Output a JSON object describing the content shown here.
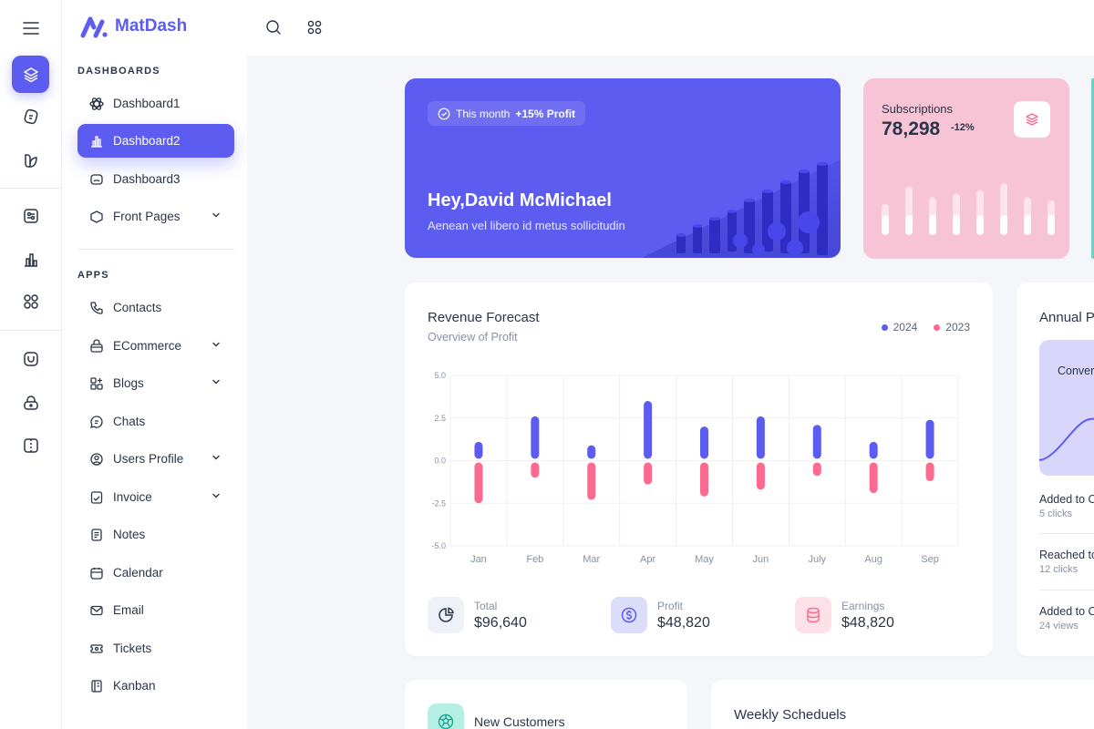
{
  "brand": {
    "name": "MatDash"
  },
  "sidebar": {
    "section_dashboards": "DASHBOARDS",
    "section_apps": "APPS",
    "dashboards": [
      {
        "label": "Dashboard1",
        "icon": "atom-icon"
      },
      {
        "label": "Dashboard2",
        "icon": "bar-chart-icon",
        "active": true
      },
      {
        "label": "Dashboard3",
        "icon": "monitor-icon"
      },
      {
        "label": "Front Pages",
        "icon": "hexagon-icon",
        "has_submenu": true
      }
    ],
    "apps": [
      {
        "label": "Contacts",
        "icon": "phone-icon"
      },
      {
        "label": "ECommerce",
        "icon": "basket-icon",
        "has_submenu": true
      },
      {
        "label": "Blogs",
        "icon": "blocks-icon",
        "has_submenu": true
      },
      {
        "label": "Chats",
        "icon": "chat-icon"
      },
      {
        "label": "Users Profile",
        "icon": "user-circle-icon",
        "has_submenu": true
      },
      {
        "label": "Invoice",
        "icon": "invoice-icon",
        "has_submenu": true
      },
      {
        "label": "Notes",
        "icon": "notes-icon"
      },
      {
        "label": "Calendar",
        "icon": "calendar-icon"
      },
      {
        "label": "Email",
        "icon": "mail-icon"
      },
      {
        "label": "Tickets",
        "icon": "ticket-icon"
      },
      {
        "label": "Kanban",
        "icon": "kanban-icon"
      }
    ]
  },
  "hero": {
    "badge_prefix": "This month",
    "badge_value": "+15% Profit",
    "title": "Hey,David McMichael",
    "subtitle": "Aenean vel libero id metus sollicitudin"
  },
  "subscriptions": {
    "label": "Subscriptions",
    "value": "78,298",
    "change": "-12%",
    "bar_levels": [
      0.45,
      0.7,
      0.55,
      0.6,
      0.65,
      0.75,
      0.55,
      0.5
    ]
  },
  "revenue": {
    "title": "Revenue Forecast",
    "subtitle": "Overview of Profit",
    "stats": [
      {
        "label": "Total",
        "value": "$96,640",
        "icon": "pie-chart-icon"
      },
      {
        "label": "Profit",
        "value": "$48,820",
        "icon": "dollar-icon"
      },
      {
        "label": "Earnings",
        "value": "$48,820",
        "icon": "database-icon"
      }
    ]
  },
  "chart_data": {
    "type": "bar",
    "categories": [
      "Jan",
      "Feb",
      "Mar",
      "Apr",
      "May",
      "Jun",
      "July",
      "Aug",
      "Sep"
    ],
    "series": [
      {
        "name": "2024",
        "color": "#5d5cf0",
        "values": [
          1.1,
          2.6,
          0.9,
          3.5,
          2.0,
          2.6,
          2.1,
          1.1,
          2.4
        ]
      },
      {
        "name": "2023",
        "color": "#fb6a8f",
        "values": [
          -2.5,
          -1.0,
          -2.3,
          -1.4,
          -2.1,
          -1.7,
          -0.9,
          -1.9,
          -1.2
        ]
      }
    ],
    "yticks": [
      "5.0",
      "2.5",
      "0.0",
      "-2.5",
      "-5.0"
    ],
    "ylim": [
      -5,
      5
    ],
    "grid": true,
    "legend_position": "top-right"
  },
  "annual": {
    "title": "Annual P",
    "box_label": "Conver",
    "items": [
      {
        "title": "Added to C",
        "sub": "5 clicks"
      },
      {
        "title": "Reached to",
        "sub": "12 clicks"
      },
      {
        "title": "Added to C",
        "sub": "24 views"
      }
    ]
  },
  "new_customers": {
    "title": "New Customers"
  },
  "weekly": {
    "title": "Weekly Scheduels"
  },
  "colors": {
    "primary": "#5d5cf0",
    "pink": "#fb6a8f",
    "subs_bg": "#f6c4d5",
    "teal": "#5ad9c6"
  }
}
